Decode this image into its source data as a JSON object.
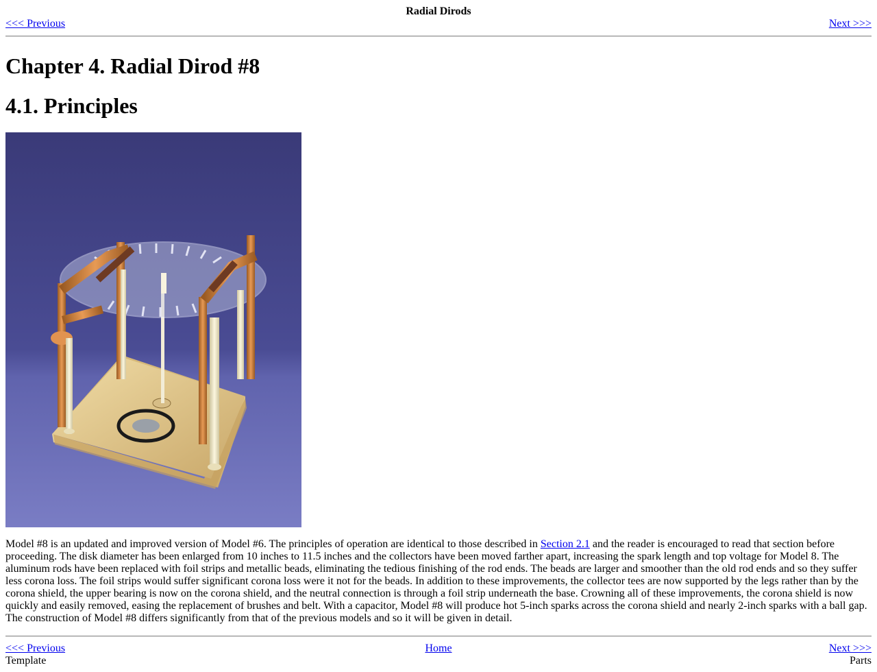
{
  "header": {
    "title": "Radial Dirods",
    "prev_label": "<<< Previous",
    "next_label": "Next >>>"
  },
  "chapter_title": "Chapter 4. Radial Dirod #8",
  "section_title": "4.1. Principles",
  "figure": {
    "subject": "photo-radial-dirod-model-8",
    "colors": {
      "backdrop_top": "#3a3a78",
      "backdrop_bottom": "#6d70bb",
      "wood_base": "#e3c98f",
      "copper": "#c8772f",
      "acrylic_disk": "#c9cfe8",
      "rods": "#efe8c8"
    }
  },
  "paragraph": {
    "part1": "Model #8 is an updated and improved version of Model #6. The principles of operation are identical to those described in ",
    "link": "Section 2.1",
    "part2": " and the reader is encouraged to read that section before proceeding. The disk diameter has been enlarged from 10 inches to 11.5 inches and the collectors have been moved farther apart, increasing the spark length and top voltage for Model 8. The aluminum rods have been replaced with foil strips and metallic beads, eliminating the tedious finishing of the rod ends. The beads are larger and smoother than the old rod ends and so they suffer less corona loss. The foil strips would suffer significant corona loss were it not for the beads. In addition to these improvements, the collector tees are now supported by the legs rather than by the corona shield, the upper bearing is now on the corona shield, and the neutral connection is through a foil strip underneath the base. Crowning all of these improvements, the corona shield is now quickly and easily removed, easing the replacement of brushes and belt. With a capacitor, Model #8 will produce hot 5-inch sparks across the corona shield and nearly 2-inch sparks with a ball gap. The construction of Model #8 differs significantly from that of the previous models and so it will be given in detail."
  },
  "footer": {
    "prev_label": "<<< Previous",
    "home_label": "Home",
    "next_label": "Next >>>",
    "prev_title": "Template",
    "next_title": "Parts"
  },
  "colors": {
    "link": "#0000ee",
    "text": "#000000",
    "rule": "#8c8c8c"
  }
}
